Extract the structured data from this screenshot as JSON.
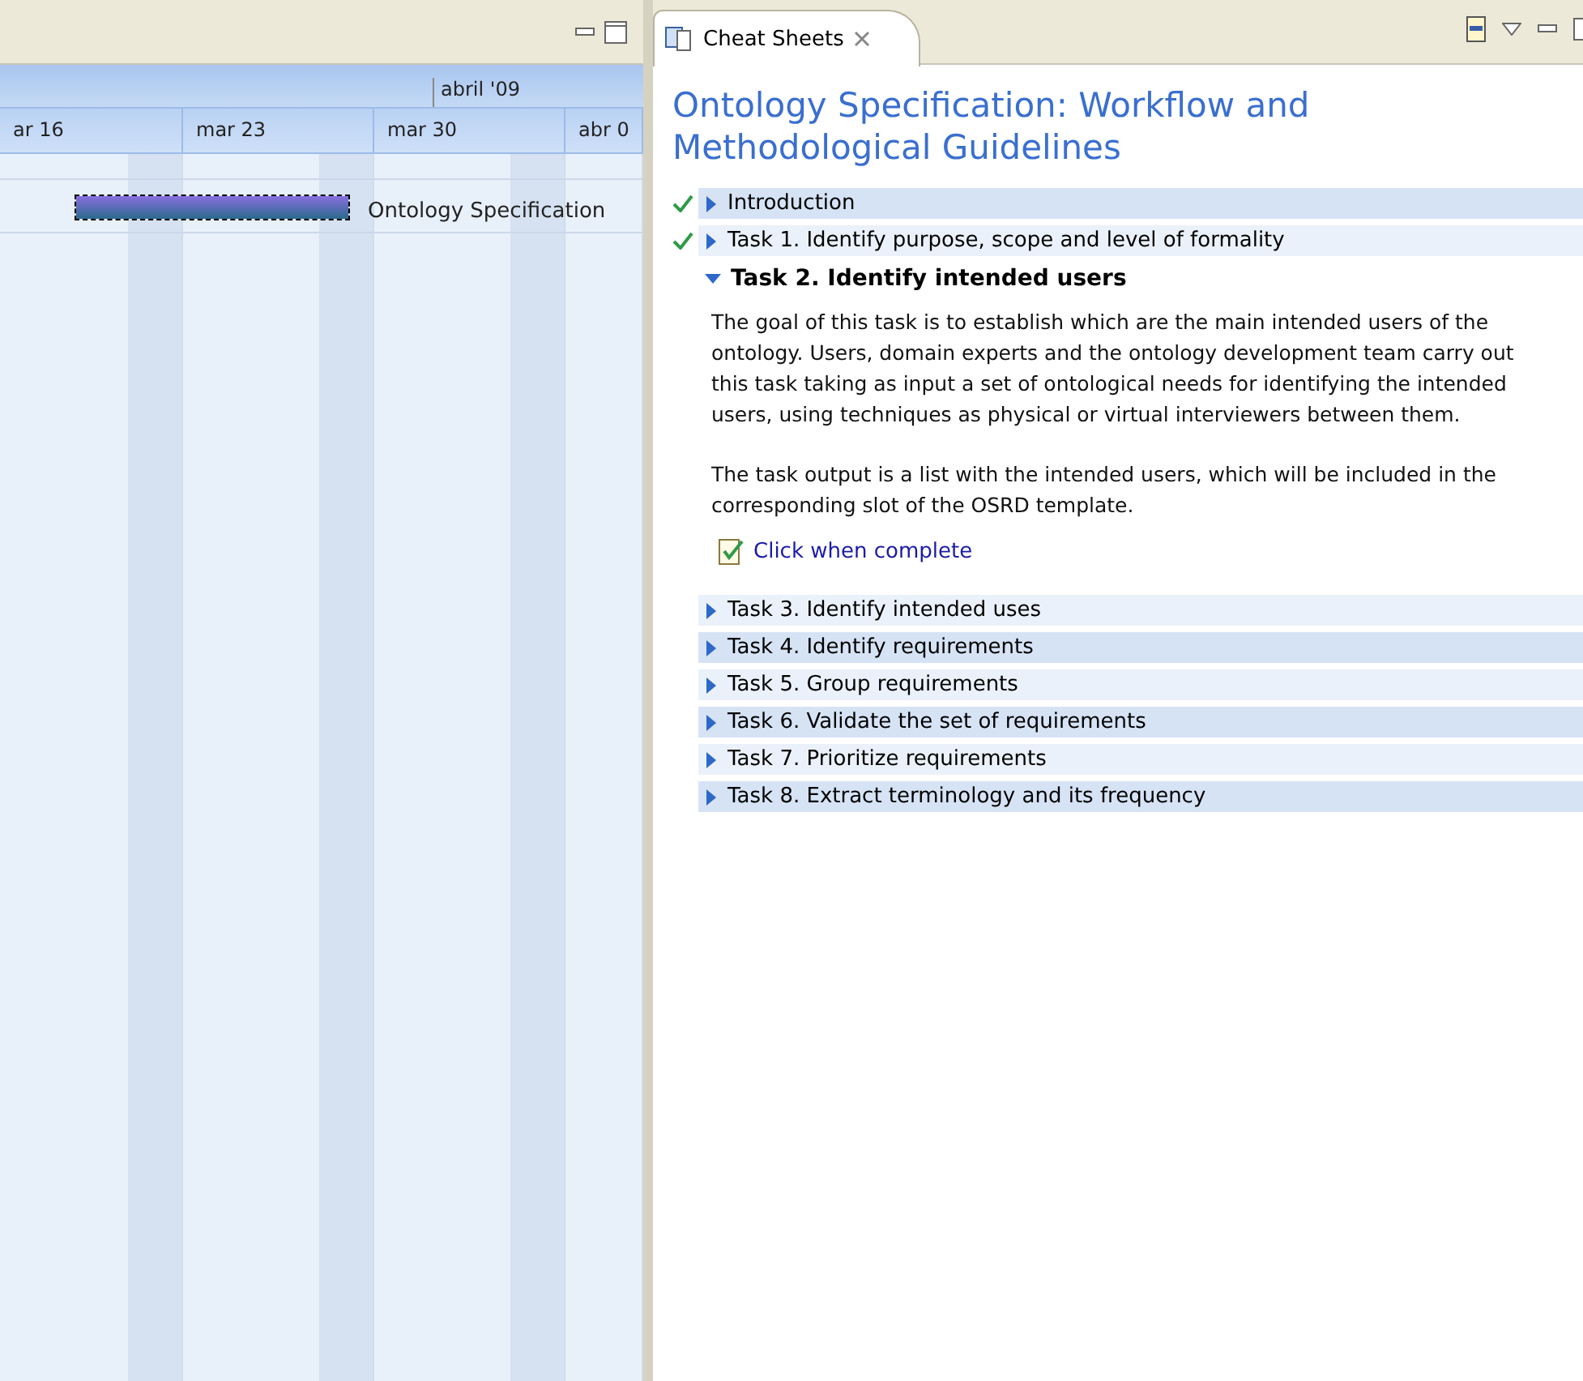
{
  "gantt": {
    "month_label": "abril '09",
    "weeks": [
      {
        "label": "ar 16"
      },
      {
        "label": "mar 23"
      },
      {
        "label": "mar 30"
      },
      {
        "label": "abr 0"
      }
    ],
    "task": {
      "label": "Ontology Specification",
      "selected": true
    }
  },
  "cheat_sheets": {
    "tab": {
      "label": "Cheat Sheets",
      "selected": true
    },
    "title": "Ontology Specification: Workflow and Methodological Guidelines",
    "items": [
      {
        "label": "Introduction",
        "completed": true,
        "expanded": false
      },
      {
        "label": "Task 1. Identify purpose, scope and level of formality",
        "completed": true,
        "expanded": false
      },
      {
        "label": "Task 2. Identify intended users",
        "completed": false,
        "expanded": true,
        "paragraphs": [
          "The goal of this task is to establish which are the main intended users of the ontology. Users, domain experts and the ontology development team carry out this task taking as input a set of ontological needs for identifying the intended users, using techniques as physical or virtual interviewers between them.",
          "The task output is a list with the intended users, which will be included in the corresponding slot of the OSRD template."
        ],
        "action": "Click when complete"
      },
      {
        "label": "Task 3. Identify intended uses",
        "completed": false,
        "expanded": false
      },
      {
        "label": "Task 4. Identify requirements",
        "completed": false,
        "expanded": false
      },
      {
        "label": "Task 5. Group requirements",
        "completed": false,
        "expanded": false
      },
      {
        "label": "Task 6. Validate the set of requirements",
        "completed": false,
        "expanded": false
      },
      {
        "label": "Task 7. Prioritize requirements",
        "completed": false,
        "expanded": false
      },
      {
        "label": "Task 8. Extract terminology and its frequency",
        "completed": false,
        "expanded": false
      }
    ]
  }
}
